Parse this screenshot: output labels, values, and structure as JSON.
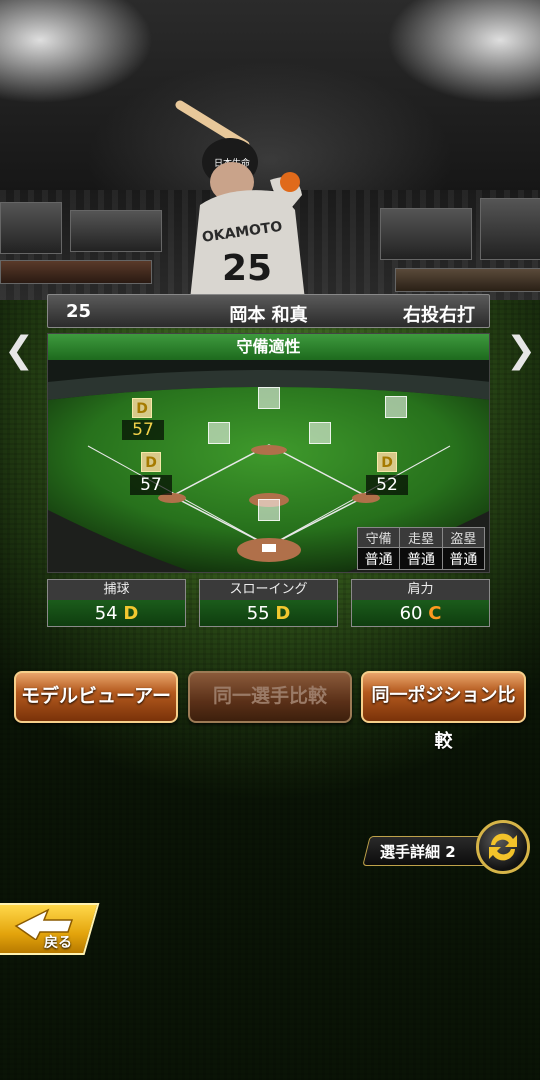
{
  "player": {
    "number": "25",
    "name": "岡本 和真",
    "handedness": "右投右打",
    "jersey_name": "OKAMOTO",
    "jersey_number": "25"
  },
  "fielding": {
    "title": "守備適性",
    "positions": [
      {
        "pos": "left-field",
        "grade": "D",
        "value": "57",
        "highlight": true
      },
      {
        "pos": "third-base",
        "grade": "D",
        "value": "57",
        "highlight": false
      },
      {
        "pos": "first-base",
        "grade": "D",
        "value": "52",
        "highlight": false
      }
    ],
    "summary_headers": [
      "守備",
      "走塁",
      "盗塁"
    ],
    "summary_values": [
      "普通",
      "普通",
      "普通"
    ]
  },
  "stats": [
    {
      "label": "捕球",
      "value": "54",
      "grade": "D"
    },
    {
      "label": "スローイング",
      "value": "55",
      "grade": "D"
    },
    {
      "label": "肩力",
      "value": "60",
      "grade": "C"
    }
  ],
  "buttons": {
    "model_viewer": "モデルビューアー",
    "same_player_compare": "同一選手比較",
    "same_position_compare": "同一ポジション比較"
  },
  "detail": {
    "label": "選手詳細 2"
  },
  "back": {
    "label": "戻る"
  },
  "nav": {
    "prev": "❮",
    "next": "❯"
  },
  "colors": {
    "grade_d": "#f2c82f",
    "grade_c": "#ff9a1f",
    "header_green": "#2e8a2e",
    "button_orange": "#b45a1e"
  }
}
